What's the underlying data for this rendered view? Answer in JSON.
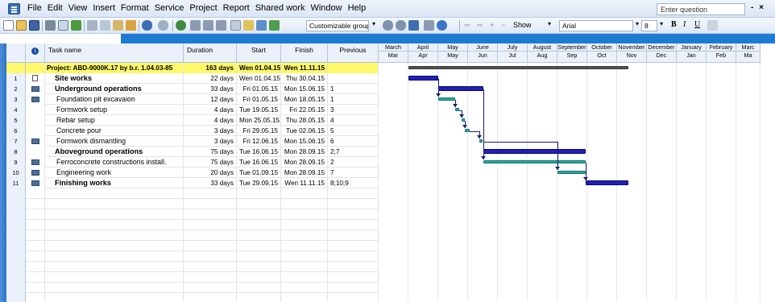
{
  "menu": {
    "items": [
      "File",
      "Edit",
      "View",
      "Insert",
      "Format",
      "Service",
      "Project",
      "Report",
      "Shared work",
      "Window",
      "Help"
    ],
    "help_placeholder": "Enter question",
    "window_controls": "- ×"
  },
  "toolbar": {
    "group_combo": "Customizable group",
    "show_label": "Show",
    "font_combo": "Arial",
    "size_combo": "8",
    "bold": "B",
    "italic": "I",
    "underline": "U"
  },
  "table": {
    "headers": {
      "info": "i",
      "task_name": "Task name",
      "duration": "Duration",
      "start": "Start",
      "finish": "Finish",
      "previous": "Previous"
    },
    "summary": {
      "name": "Project: ABD-9000K.17 by b.r. 1.04.03-85",
      "duration": "163 days",
      "start": "Wen 01.04.15",
      "finish": "Wen 11.11.15",
      "previous": ""
    },
    "rows": [
      {
        "id": "1",
        "name": "Site works",
        "duration": "22 days",
        "start": "Wen 01.04.15",
        "finish": "Thu 30.04.15",
        "previous": "",
        "bold": true,
        "indicator": "note"
      },
      {
        "id": "2",
        "name": "Underground operations",
        "duration": "33 days",
        "start": "Fri 01.05.15",
        "finish": "Mon 15.06.15",
        "previous": "1",
        "bold": true,
        "indicator": "cal"
      },
      {
        "id": "3",
        "name": "Foundation pit excavaion",
        "duration": "12 days",
        "start": "Fri 01.05.15",
        "finish": "Mon 18.05.15",
        "previous": "1",
        "bold": false,
        "indicator": "cal"
      },
      {
        "id": "4",
        "name": "Formwork setup",
        "duration": "4 days",
        "start": "Tue 19.05.15",
        "finish": "Fri 22.05.15",
        "previous": "3",
        "bold": false,
        "indicator": ""
      },
      {
        "id": "5",
        "name": "Rebar setup",
        "duration": "4 days",
        "start": "Mon 25.05.15",
        "finish": "Thu 28.05.15",
        "previous": "4",
        "bold": false,
        "indicator": ""
      },
      {
        "id": "6",
        "name": "Concrete pour",
        "duration": "3 days",
        "start": "Fri 29.05.15",
        "finish": "Tue 02.06.15",
        "previous": "5",
        "bold": false,
        "indicator": ""
      },
      {
        "id": "7",
        "name": "Formwork dismantling",
        "duration": "3 days",
        "start": "Fri 12.06.15",
        "finish": "Mon 15.06.15",
        "previous": "6",
        "bold": false,
        "indicator": "cal"
      },
      {
        "id": "8",
        "name": "Aboveground operations",
        "duration": "75 days",
        "start": "Tue 16.06.15",
        "finish": "Mon 28.09.15",
        "previous": "2;7",
        "bold": true,
        "indicator": ""
      },
      {
        "id": "9",
        "name": "Ferroconcrete constructions install.",
        "duration": "75 days",
        "start": "Tue 16.06.15",
        "finish": "Mon 28.09.15",
        "previous": "2",
        "bold": false,
        "indicator": "cal"
      },
      {
        "id": "10",
        "name": "Engineering work",
        "duration": "20 days",
        "start": "Tue 01.09.15",
        "finish": "Mon 28.09.15",
        "previous": "7",
        "bold": false,
        "indicator": "cal"
      },
      {
        "id": "11",
        "name": "Finishing works",
        "duration": "33 days",
        "start": "Tue 29.09.15",
        "finish": "Wen 11.11.15",
        "previous": "8;10;9",
        "bold": true,
        "indicator": "cal"
      }
    ]
  },
  "timescale": {
    "top": [
      "March",
      "April",
      "May",
      "June",
      "July",
      "August",
      "September",
      "October",
      "November",
      "December",
      "January",
      "February",
      "Marc"
    ],
    "bottom": [
      "Mar",
      "Apr",
      "May",
      "Jun",
      "Jul",
      "Aug",
      "Sep",
      "Oct",
      "Nov",
      "Dec",
      "Jan",
      "Feb",
      "Ma"
    ]
  },
  "colors": {
    "summary_row": "#fff86a",
    "summary_bar": "#1f1fb8",
    "task_bar": "#2aa6a0",
    "entry_bar": "#1f7ad3"
  }
}
